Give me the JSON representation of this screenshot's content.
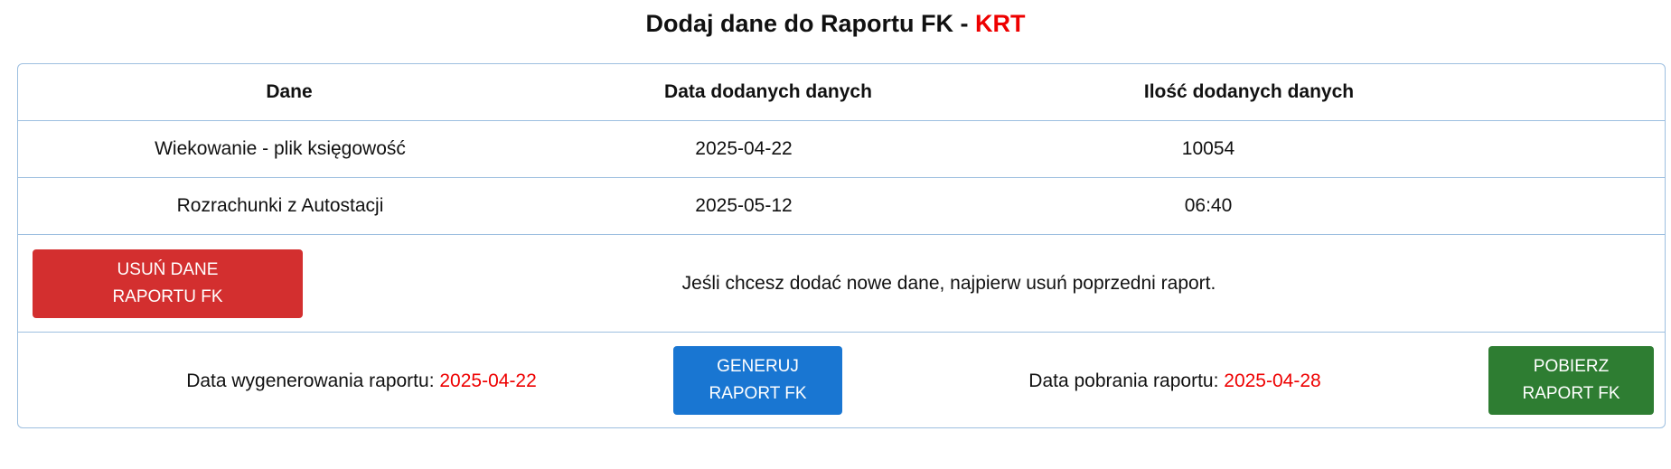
{
  "header": {
    "title": "Dodaj dane do Raportu FK - ",
    "title_accent": "KRT"
  },
  "table": {
    "columns": [
      "Dane",
      "Data dodanych danych",
      "Ilość dodanych danych"
    ],
    "rows": [
      {
        "name": "Wiekowanie - plik księgowość",
        "date": "2025-04-22",
        "count": "10054"
      },
      {
        "name": "Rozrachunki z Autostacji",
        "date": "2025-05-12",
        "count": "06:40"
      }
    ]
  },
  "delete_section": {
    "button_line1": "USUŃ DANE",
    "button_line2": "RAPORTU FK",
    "message": "Jeśli chcesz dodać nowe dane, najpierw usuń poprzedni raport."
  },
  "report_section": {
    "generated_label": "Data wygenerowania raportu: ",
    "generated_date": "2025-04-22",
    "generate_button_line1": "GENERUJ",
    "generate_button_line2": "RAPORT FK",
    "downloaded_label": "Data pobrania raportu: ",
    "downloaded_date": "2025-04-28",
    "download_button_line1": "POBIERZ",
    "download_button_line2": "RAPORT FK"
  },
  "colors": {
    "accent_red": "#ee0000",
    "delete_button": "#d32f2f",
    "generate_button": "#1976d2",
    "download_button": "#2e7d32",
    "border": "#9dbfe0"
  }
}
